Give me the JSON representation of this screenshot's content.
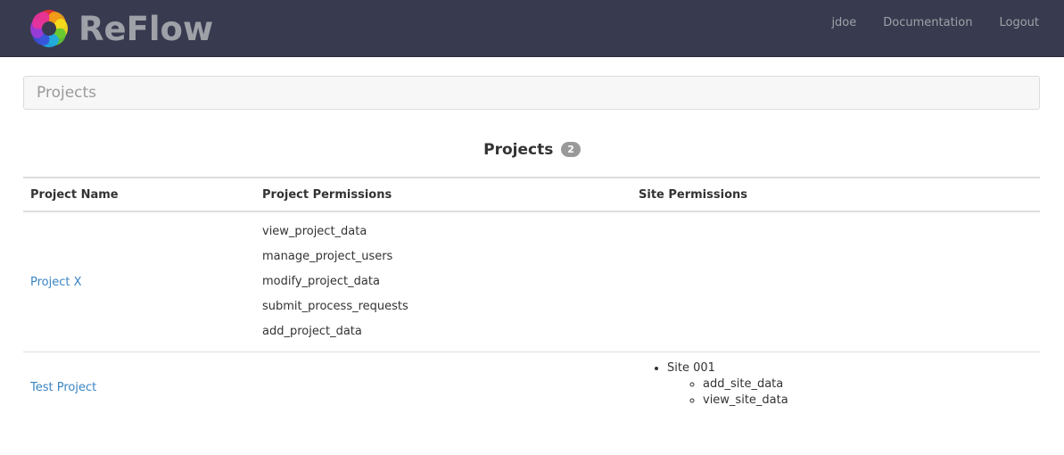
{
  "app": {
    "brand": "ReFlow",
    "logo_colors": [
      "#e8322e",
      "#f4a417",
      "#f7e11c",
      "#5fc832",
      "#1ea9e8",
      "#3a4fd8",
      "#a03ad8",
      "#e8339a"
    ]
  },
  "nav": {
    "user": "jdoe",
    "documentation": "Documentation",
    "logout": "Logout"
  },
  "breadcrumb": {
    "current": "Projects"
  },
  "section": {
    "title": "Projects",
    "count": "2"
  },
  "table": {
    "headers": [
      "Project Name",
      "Project Permissions",
      "Site Permissions"
    ],
    "rows": [
      {
        "name": "Project X",
        "project_permissions": [
          "view_project_data",
          "manage_project_users",
          "modify_project_data",
          "submit_process_requests",
          "add_project_data"
        ],
        "sites": []
      },
      {
        "name": "Test Project",
        "project_permissions": [],
        "sites": [
          {
            "name": "Site 001",
            "permissions": [
              "add_site_data",
              "view_site_data"
            ]
          }
        ]
      }
    ]
  }
}
